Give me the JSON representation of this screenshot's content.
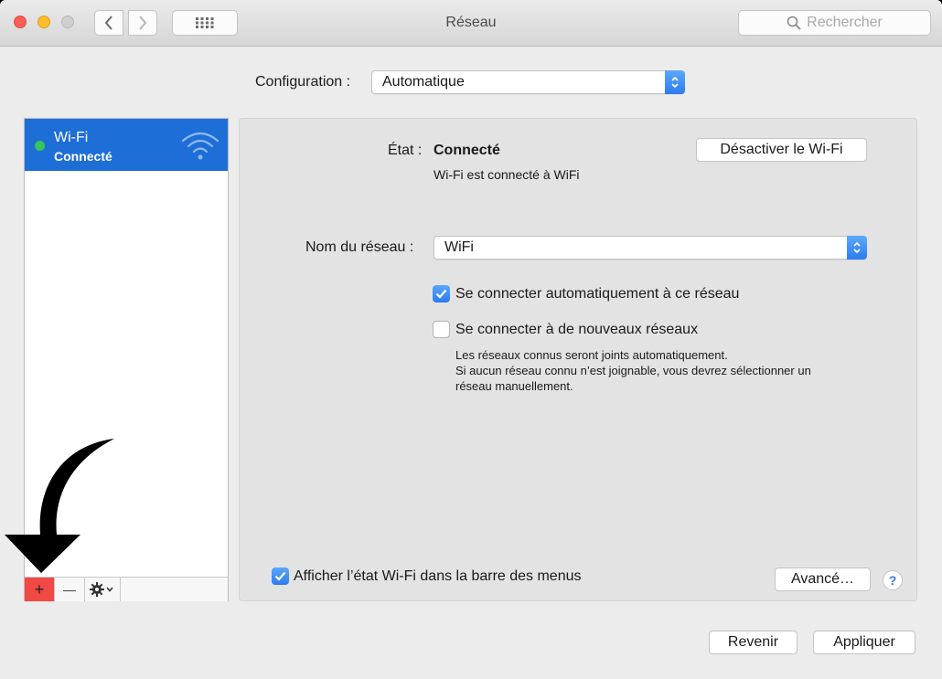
{
  "window": {
    "title": "Réseau"
  },
  "search": {
    "placeholder": "Rechercher"
  },
  "configuration": {
    "label": "Configuration :",
    "value": "Automatique"
  },
  "sidebar": {
    "items": [
      {
        "name": "Wi-Fi",
        "status": "Connecté",
        "status_color": "#34c759"
      }
    ],
    "add_label": "+",
    "remove_label": "—"
  },
  "status": {
    "label": "État :",
    "value": "Connecté",
    "detail": "Wi-Fi est connecté à WiFi",
    "toggle_button": "Désactiver le Wi-Fi"
  },
  "network_name": {
    "label": "Nom du réseau :",
    "value": "WiFi"
  },
  "options": {
    "auto_join": {
      "label": "Se connecter automatiquement à ce réseau",
      "checked": true
    },
    "ask_new": {
      "label": "Se connecter à de nouveaux réseaux",
      "checked": false
    },
    "note_lines": [
      "Les réseaux connus seront joints automatiquement.",
      "Si aucun réseau connu n’est joignable, vous devrez sélectionner un",
      "réseau manuellement."
    ]
  },
  "footer": {
    "show_status": {
      "label": "Afficher l’état Wi-Fi dans la barre des menus",
      "checked": true
    },
    "advanced_button": "Avancé…",
    "help_label": "?",
    "revert_button": "Revenir",
    "apply_button": "Appliquer"
  },
  "colors": {
    "accent": "#1e6ed7",
    "highlight_add": "#f04a45"
  }
}
